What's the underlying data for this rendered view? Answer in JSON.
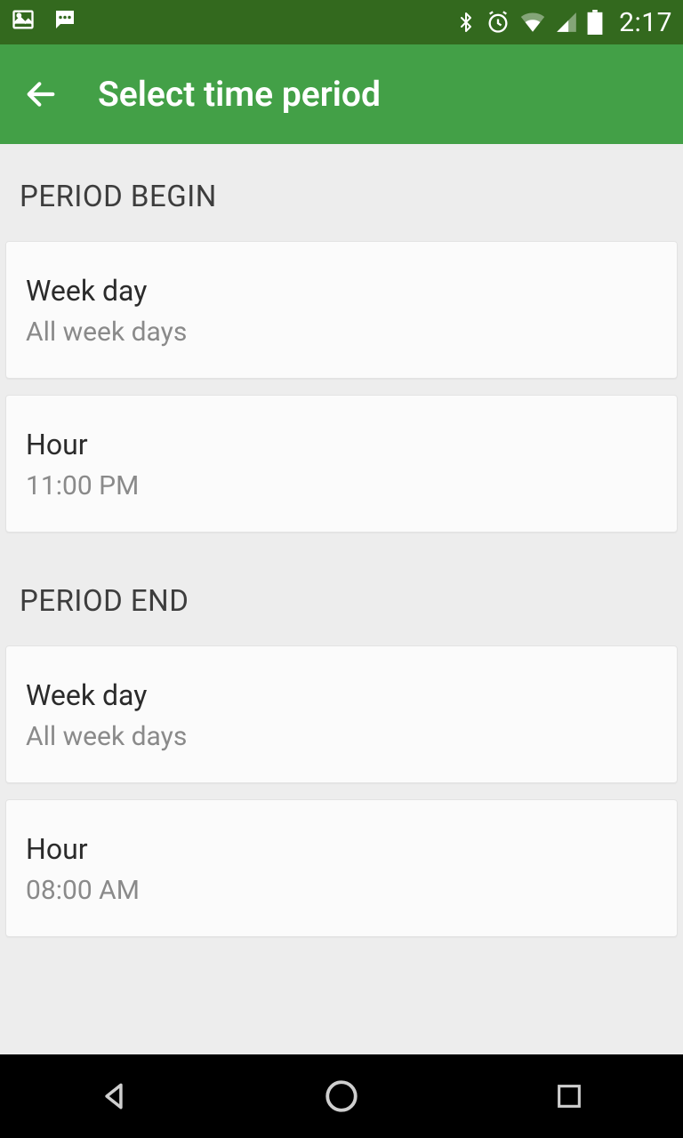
{
  "statusbar": {
    "time": "2:17"
  },
  "appbar": {
    "title": "Select time period"
  },
  "sections": {
    "begin": {
      "header": "PERIOD BEGIN",
      "weekday": {
        "label": "Week day",
        "value": "All week days"
      },
      "hour": {
        "label": "Hour",
        "value": "11:00 PM"
      }
    },
    "end": {
      "header": "PERIOD END",
      "weekday": {
        "label": "Week day",
        "value": "All week days"
      },
      "hour": {
        "label": "Hour",
        "value": "08:00 AM"
      }
    }
  }
}
